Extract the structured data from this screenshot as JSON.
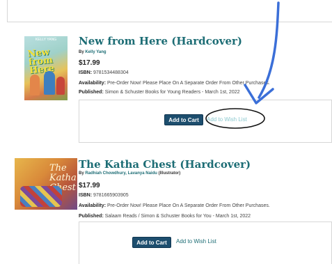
{
  "products": [
    {
      "title": "New from Here (Hardcover)",
      "by_prefix": "By ",
      "authors": "Kelly Yang",
      "price": "$17.99",
      "isbn_label": "ISBN:",
      "isbn": "9781534488304",
      "availability_label": "Availability:",
      "availability": "Pre-Order Now! Please Place On A Separate Order From Other Purchases.",
      "published_label": "Published:",
      "published": "Simon & Schuster Books for Young Readers - March 1st, 2022",
      "add_to_cart": "Add to Cart",
      "wish_list": "Add to Wish List",
      "cover_title": "New from Here",
      "cover_author": "KELLY YANG"
    },
    {
      "title": "The Katha Chest (Hardcover)",
      "by_prefix": "By ",
      "authors": "Radhiah Chowdhury, Lavanya Naidu",
      "author_role": " (Illustrator)",
      "price": "$17.99",
      "isbn_label": "ISBN:",
      "isbn": "9781665903905",
      "availability_label": "Availability:",
      "availability": "Pre-Order Now! Please Place On A Separate Order From Other Purchases.",
      "published_label": "Published:",
      "published": "Salaam Reads / Simon & Schuster Books for You - March 1st, 2022",
      "add_to_cart": "Add to Cart",
      "wish_list": "Add to Wish List",
      "cover_title": "The Katha Chest"
    }
  ],
  "annotation": {
    "color": "#3b6fd8",
    "circle_color": "#111111"
  }
}
